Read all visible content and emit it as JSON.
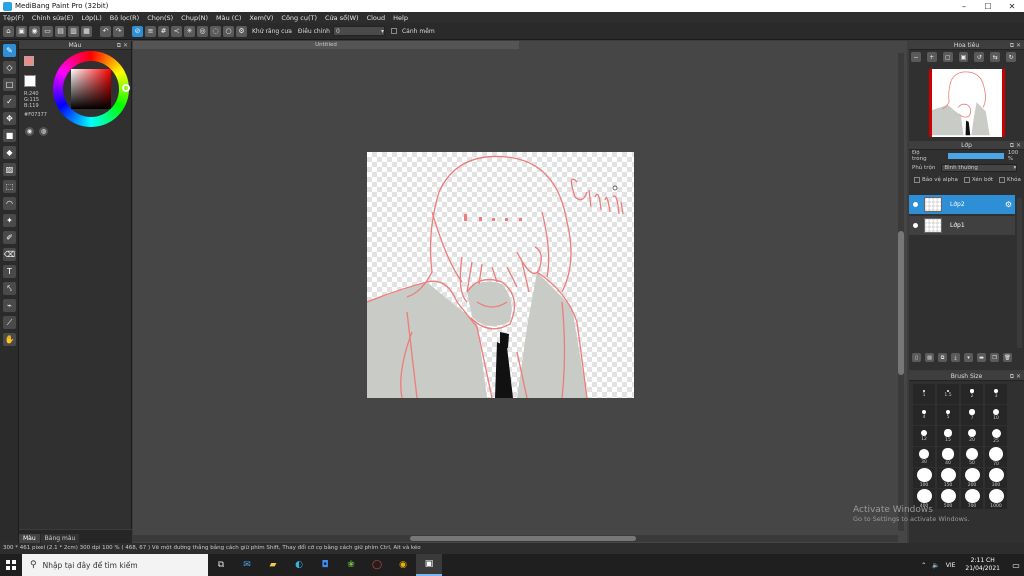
{
  "window": {
    "title": "MediBang Paint Pro (32bit)",
    "min": "–",
    "max": "☐",
    "close": "✕"
  },
  "menu": [
    "Tệp(F)",
    "Chỉnh sửa(E)",
    "Lớp(L)",
    "Bộ lọc(R)",
    "Chọn(S)",
    "Chụp(N)",
    "Màu (C)",
    "Xem(V)",
    "Công cụ(T)",
    "Cửa sổ(W)",
    "Cloud",
    "Help"
  ],
  "toolbar": {
    "antialias_label": "Khử răng cưa",
    "correction_label": "Điều chỉnh",
    "correction_value": "0",
    "brush_label": "Cảnh mềm"
  },
  "color_panel": {
    "title": "Màu",
    "r": "R:240",
    "g": "G:115",
    "b": "B:119",
    "hex": "#F07377",
    "fg_color": "#f07377",
    "tabs": [
      "Màu",
      "Bảng màu"
    ]
  },
  "document": {
    "tab_title": "Untitled"
  },
  "navigator": {
    "title": "Hoa tiêu"
  },
  "layers": {
    "title": "Lớp",
    "opacity_label": "Độ trong",
    "opacity_value": "100 %",
    "opacity_fraction": 1.0,
    "blend_label": "Phủ trộn",
    "blend_value": "Bình thường",
    "protect_alpha": "Bảo vệ alpha",
    "clipping": "Xén bớt",
    "lock": "Khóa",
    "items": [
      {
        "name": "Lớp2",
        "selected": true
      },
      {
        "name": "Lớp1",
        "selected": false
      }
    ]
  },
  "brush_size": {
    "title": "Brush Size",
    "sizes": [
      "1",
      "1.5",
      "2",
      "3",
      "4",
      "5",
      "7",
      "10",
      "12",
      "15",
      "20",
      "25",
      "30",
      "40",
      "50",
      "70",
      "100",
      "150",
      "200",
      "300",
      "400",
      "500",
      "700",
      "1000"
    ]
  },
  "watermark": {
    "line1": "Activate Windows",
    "line2": "Go to Settings to activate Windows."
  },
  "status": "300 * 461 pixel  (2.1 * 2cm)  300 dpi  100 %  ( 468, 67 )  Vẽ một đường thẳng bằng cách giữ phím Shift, Thay đổi cỡ cọ bằng cách giữ phím Ctrl, Alt và kéo",
  "taskbar": {
    "search_placeholder": "Nhập tại đây để tìm kiếm",
    "lang": "VIE",
    "time": "2:11 CH",
    "date": "21/04/2021"
  }
}
